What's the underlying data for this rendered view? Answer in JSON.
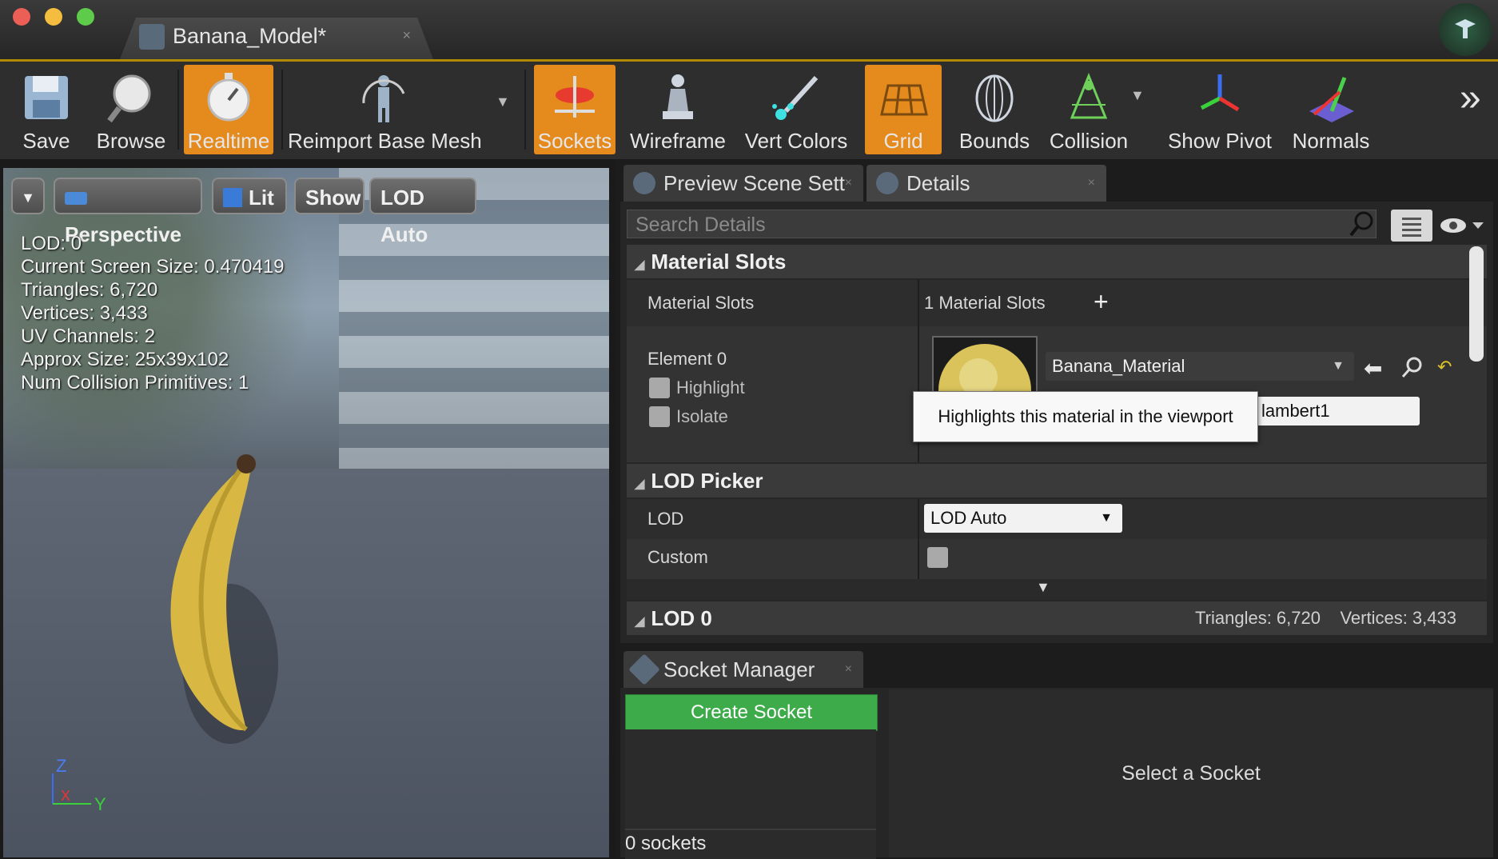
{
  "window": {
    "tab_title": "Banana_Model*",
    "tab_close": "×"
  },
  "toolbar": {
    "save": "Save",
    "browse": "Browse",
    "realtime": "Realtime",
    "reimport": "Reimport Base Mesh",
    "sockets": "Sockets",
    "wireframe": "Wireframe",
    "vert_colors": "Vert Colors",
    "grid": "Grid",
    "bounds": "Bounds",
    "collision": "Collision",
    "show_pivot": "Show Pivot",
    "normals": "Normals",
    "overflow": "»"
  },
  "viewport": {
    "controls": {
      "perspective": "Perspective",
      "lit": "Lit",
      "show": "Show",
      "lod": "LOD Auto"
    },
    "stats": {
      "lod": "LOD:  0",
      "screen_size": "Current Screen Size:  0.470419",
      "triangles": "Triangles:  6,720",
      "vertices": "Vertices:  3,433",
      "uv_channels": "UV Channels:  2",
      "approx_size": "Approx Size: 25x39x102",
      "collision": "Num Collision Primitives:  1"
    },
    "axis": {
      "z": "Z",
      "x": "X",
      "y": "Y"
    }
  },
  "panels": {
    "tab_preview": "Preview Scene Sett",
    "tab_details": "Details",
    "search_placeholder": "Search Details",
    "material_section": "Material Slots",
    "material_slots_label": "Material Slots",
    "material_slots_value": "1 Material Slots",
    "element_label": "Element 0",
    "highlight_label": "Highlight",
    "isolate_label": "Isolate",
    "material_name": "Banana_Material",
    "slot_name": "lambert1",
    "tooltip": "Highlights this material in the viewport",
    "lod_picker_section": "LOD Picker",
    "lod_label": "LOD",
    "lod_value": "LOD Auto",
    "custom_label": "Custom",
    "lod0_section": "LOD 0",
    "lod0_triangles": "Triangles: 6,720",
    "lod0_vertices": "Vertices: 3,433"
  },
  "sockets": {
    "tab": "Socket Manager",
    "create": "Create Socket",
    "count": "0 sockets",
    "placeholder": "Select a Socket"
  },
  "colors": {
    "accent_active": "#e58a1c",
    "create_button": "#3dab4a"
  }
}
